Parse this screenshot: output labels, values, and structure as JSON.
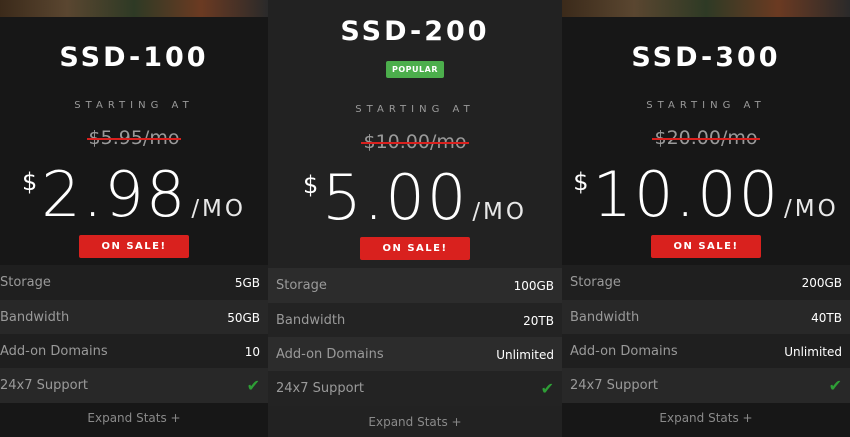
{
  "plans": [
    {
      "name": "SSD-100",
      "starting_label": "STARTING AT",
      "old_price": "$5.95/mo",
      "currency": "$",
      "price": "2.98",
      "period": "/MO",
      "sale_label": "ON SALE!",
      "features": [
        {
          "label": "Storage",
          "value": "5GB"
        },
        {
          "label": "Bandwidth",
          "value": "50GB"
        },
        {
          "label": "Add-on Domains",
          "value": "10"
        },
        {
          "label": "24x7 Support",
          "value": "check-icon"
        }
      ],
      "expand_label": "Expand Stats +"
    },
    {
      "name": "SSD-200",
      "badge": "POPULAR",
      "starting_label": "STARTING AT",
      "old_price": "$10.00/mo",
      "currency": "$",
      "price": "5.00",
      "period": "/MO",
      "sale_label": "ON SALE!",
      "features": [
        {
          "label": "Storage",
          "value": "100GB"
        },
        {
          "label": "Bandwidth",
          "value": "20TB"
        },
        {
          "label": "Add-on Domains",
          "value": "Unlimited"
        },
        {
          "label": "24x7 Support",
          "value": "check-icon"
        }
      ],
      "expand_label": "Expand Stats +"
    },
    {
      "name": "SSD-300",
      "starting_label": "STARTING AT",
      "old_price": "$20.00/mo",
      "currency": "$",
      "price": "10.00",
      "period": "/MO",
      "sale_label": "ON SALE!",
      "features": [
        {
          "label": "Storage",
          "value": "200GB"
        },
        {
          "label": "Bandwidth",
          "value": "40TB"
        },
        {
          "label": "Add-on Domains",
          "value": "Unlimited"
        },
        {
          "label": "24x7 Support",
          "value": "check-icon"
        }
      ],
      "expand_label": "Expand Stats +"
    }
  ],
  "colors": {
    "sale_red": "#d9211e",
    "popular_green": "#4cae4c",
    "check_green": "#2e9e36",
    "background": "#171717",
    "featured_background": "#222222"
  }
}
